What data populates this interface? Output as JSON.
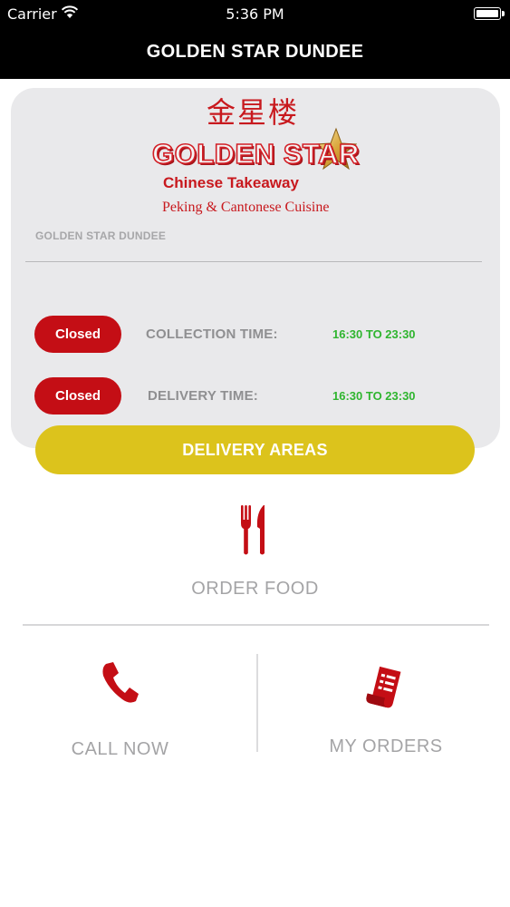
{
  "status_bar": {
    "carrier": "Carrier",
    "time": "5:36 PM",
    "wifi_icon": "wifi-icon",
    "battery_icon": "battery-icon"
  },
  "nav": {
    "title": "GOLDEN STAR DUNDEE"
  },
  "logo": {
    "chinese_name": "金星楼",
    "name": "GOLDEN STAR",
    "subtitle": "Chinese Takeaway",
    "cuisine": "Peking & Cantonese Cuisine",
    "star_icon": "star-icon"
  },
  "restaurant": {
    "name": "GOLDEN STAR DUNDEE"
  },
  "hours": [
    {
      "status": "Closed",
      "label": "COLLECTION TIME:",
      "time": "16:30 TO 23:30"
    },
    {
      "status": "Closed",
      "label": "DELIVERY TIME:",
      "time": "16:30 TO 23:30"
    }
  ],
  "delivery_areas_label": "DELIVERY AREAS",
  "menu": {
    "order_food": {
      "label": "ORDER FOOD",
      "icon": "fork-knife-icon"
    },
    "call_now": {
      "label": "CALL NOW",
      "icon": "phone-icon"
    },
    "my_orders": {
      "label": "MY ORDERS",
      "icon": "receipt-icon"
    }
  },
  "colors": {
    "brand_red": "#c40e15",
    "open_time_green": "#2fb52f",
    "delivery_button_yellow": "#dcc31c",
    "header_black": "#000000",
    "card_grey": "#e9e9eb"
  }
}
